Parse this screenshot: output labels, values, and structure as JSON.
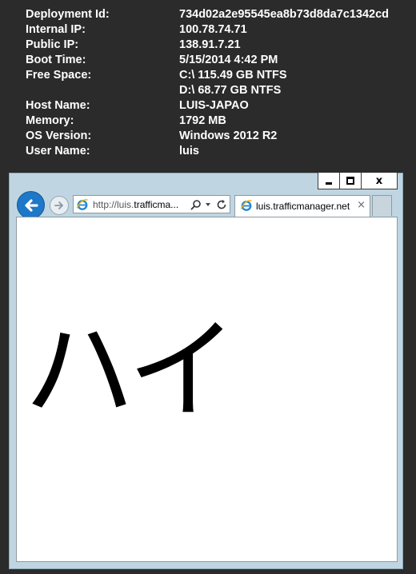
{
  "bginfo": {
    "rows": [
      {
        "label": "Deployment Id:",
        "value": "734d02a2e95545ea8b73d8da7c1342cd"
      },
      {
        "label": "Internal IP:",
        "value": "100.78.74.71"
      },
      {
        "label": "Public IP:",
        "value": "138.91.7.21"
      },
      {
        "label": "Boot Time:",
        "value": "5/15/2014 4:42 PM"
      },
      {
        "label": "Free Space:",
        "value": "C:\\ 115.49 GB NTFS"
      },
      {
        "label": "",
        "value": "D:\\ 68.77 GB NTFS"
      },
      {
        "label": "Host Name:",
        "value": "LUIS-JAPAO"
      },
      {
        "label": "Memory:",
        "value": "1792 MB"
      },
      {
        "label": "OS Version:",
        "value": "Windows 2012 R2"
      },
      {
        "label": "User Name:",
        "value": "luis"
      }
    ]
  },
  "browser": {
    "caption": {
      "minimize_icon": "minimize-icon",
      "maximize_icon": "maximize-icon",
      "close_label": "x"
    },
    "address": {
      "prefix": "http://luis.",
      "domain": "trafficma..."
    },
    "tab": {
      "title": "luis.trafficmanager.net",
      "close_label": "×"
    },
    "content": {
      "text": "ハイ"
    }
  },
  "colors": {
    "desktop": "#2b2b2b",
    "window_frame": "#bfd6e2",
    "back_button": "#1e78c8",
    "ie_logo": "#1e88d8"
  }
}
